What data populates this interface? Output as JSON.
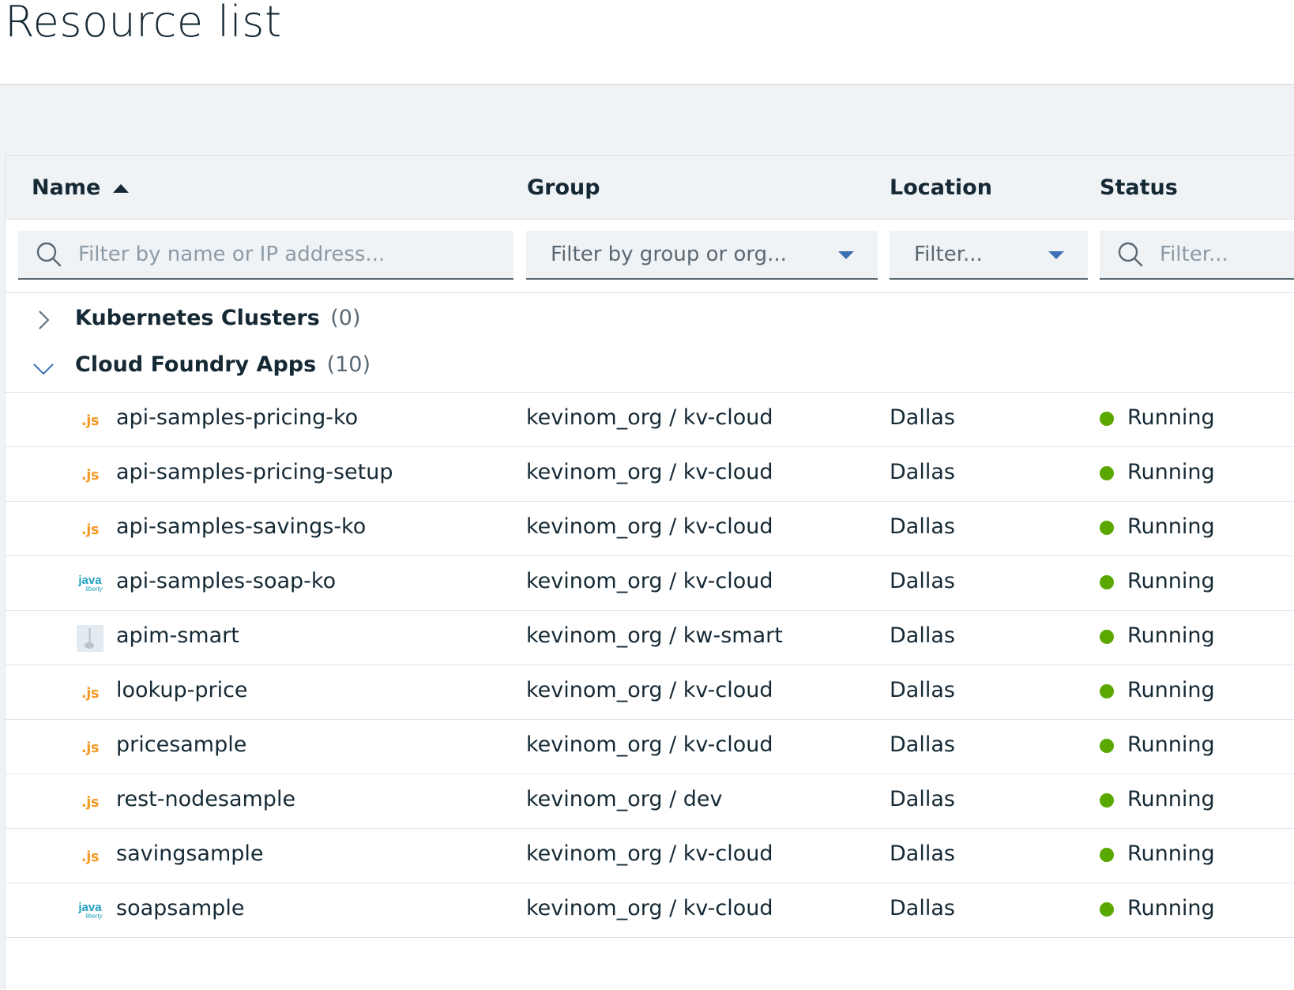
{
  "page": {
    "title": "Resource list"
  },
  "table": {
    "columns": {
      "name": "Name",
      "group": "Group",
      "location": "Location",
      "status": "Status"
    },
    "filters": {
      "name_placeholder": "Filter by name or IP address...",
      "group_placeholder": "Filter by group or org...",
      "location_placeholder": "Filter...",
      "status_placeholder": "Filter..."
    },
    "groups": [
      {
        "label": "Kubernetes Clusters",
        "count": "(0)",
        "expanded": false
      },
      {
        "label": "Cloud Foundry Apps",
        "count": "(10)",
        "expanded": true
      }
    ],
    "rows": [
      {
        "runtime": "js",
        "runtime_label": ".js",
        "name": "api-samples-pricing-ko",
        "group": "kevinom_org / kv-cloud",
        "location": "Dallas",
        "status": "Running"
      },
      {
        "runtime": "js",
        "runtime_label": ".js",
        "name": "api-samples-pricing-setup",
        "group": "kevinom_org / kv-cloud",
        "location": "Dallas",
        "status": "Running"
      },
      {
        "runtime": "js",
        "runtime_label": ".js",
        "name": "api-samples-savings-ko",
        "group": "kevinom_org / kv-cloud",
        "location": "Dallas",
        "status": "Running"
      },
      {
        "runtime": "java",
        "runtime_label": "java",
        "runtime_sublabel": "liberty",
        "name": "api-samples-soap-ko",
        "group": "kevinom_org / kv-cloud",
        "location": "Dallas",
        "status": "Running"
      },
      {
        "runtime": "generic",
        "name": "apim-smart",
        "group": "kevinom_org / kw-smart",
        "location": "Dallas",
        "status": "Running"
      },
      {
        "runtime": "js",
        "runtime_label": ".js",
        "name": "lookup-price",
        "group": "kevinom_org / kv-cloud",
        "location": "Dallas",
        "status": "Running"
      },
      {
        "runtime": "js",
        "runtime_label": ".js",
        "name": "pricesample",
        "group": "kevinom_org / kv-cloud",
        "location": "Dallas",
        "status": "Running"
      },
      {
        "runtime": "js",
        "runtime_label": ".js",
        "name": "rest-nodesample",
        "group": "kevinom_org / dev",
        "location": "Dallas",
        "status": "Running"
      },
      {
        "runtime": "js",
        "runtime_label": ".js",
        "name": "savingsample",
        "group": "kevinom_org / kv-cloud",
        "location": "Dallas",
        "status": "Running"
      },
      {
        "runtime": "java",
        "runtime_label": "java",
        "runtime_sublabel": "liberty",
        "name": "soapsample",
        "group": "kevinom_org / kv-cloud",
        "location": "Dallas",
        "status": "Running"
      }
    ]
  },
  "colors": {
    "status_running": "#5aa700",
    "js_icon": "#f59b28",
    "java_icon": "#1f9fbf",
    "accent": "#3d70b2"
  }
}
